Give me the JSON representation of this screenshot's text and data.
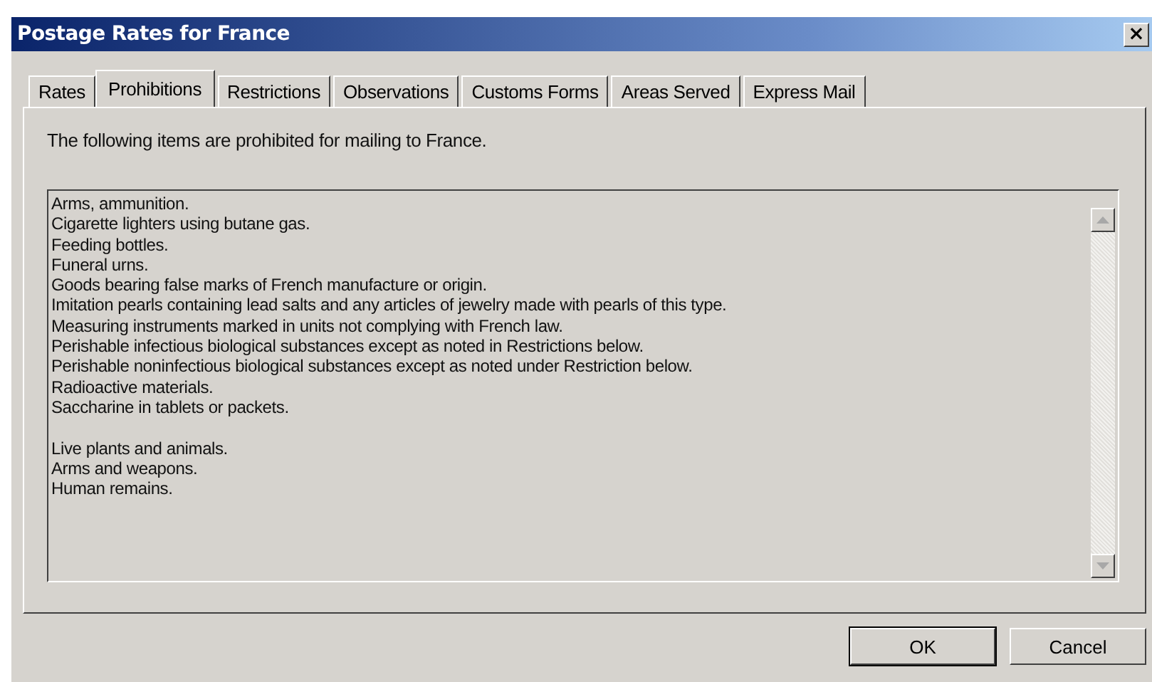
{
  "window": {
    "title": "Postage Rates for France",
    "close": "×"
  },
  "tabs": [
    {
      "label": "Rates",
      "selected": false
    },
    {
      "label": "Prohibitions",
      "selected": true
    },
    {
      "label": "Restrictions",
      "selected": false
    },
    {
      "label": "Observations",
      "selected": false
    },
    {
      "label": "Customs Forms",
      "selected": false
    },
    {
      "label": "Areas Served",
      "selected": false
    },
    {
      "label": "Express Mail",
      "selected": false
    }
  ],
  "intro": "The following items are prohibited for mailing to France.",
  "item_groups": [
    [
      "Arms, ammunition.",
      "Cigarette lighters using butane gas.",
      "Feeding bottles.",
      "Funeral urns.",
      "Goods bearing false marks of French manufacture or origin.",
      "Imitation pearls containing lead salts and any articles of jewelry made with pearls of this type.",
      "Measuring instruments marked in units not complying with French law.",
      "Perishable infectious biological substances except as noted in Restrictions below.",
      "Perishable noninfectious biological substances except as noted under Restriction below.",
      "Radioactive materials.",
      "Saccharine in tablets or packets."
    ],
    [
      "Live plants and animals.",
      "Arms and weapons.",
      "Human remains."
    ]
  ],
  "buttons": [
    {
      "label": "OK",
      "default": true
    },
    {
      "label": "Cancel",
      "default": false
    }
  ]
}
